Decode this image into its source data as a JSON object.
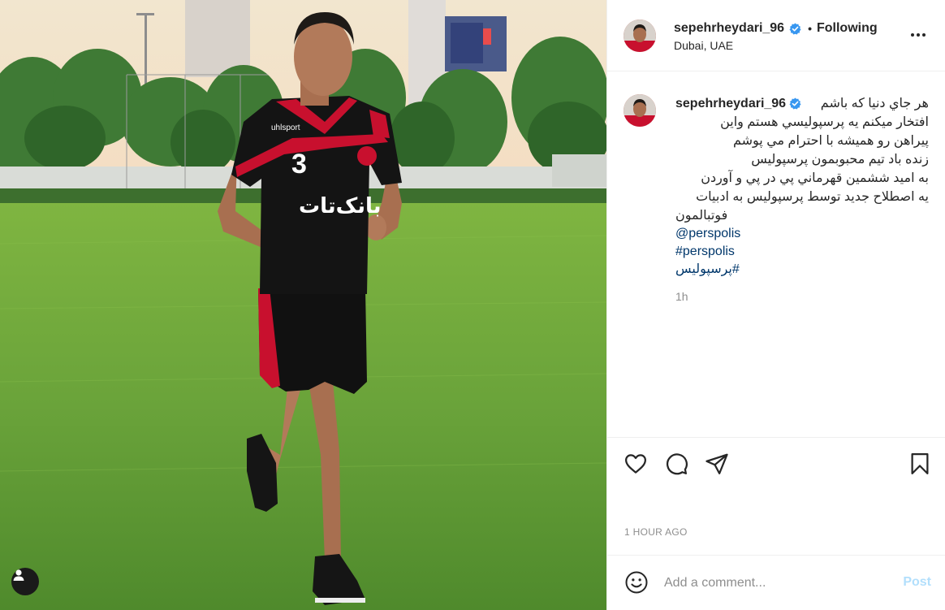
{
  "post": {
    "username": "sepehrheydari_96",
    "follow_status": "Following",
    "location": "Dubai, UAE",
    "jersey_number": "3",
    "jersey_brand": "uhlsport",
    "jersey_sponsor": "بانک‌تات"
  },
  "caption": {
    "username": "sepehrheydari_96",
    "lines": [
      "هر جاي دنيا كه باشم",
      "افتخار ميكنم يه پرسپوليسي هستم واين",
      "پيراهن رو هميشه با احترام مي پوشم",
      "زنده باد تيم محبوبمون پرسپوليس",
      "به اميد ششمين قهرماني پي در پي و آوردن",
      "يه اصطلاح جديد توسط پرسپوليس به ادبيات",
      "فوتبالمون"
    ],
    "mention": "@perspolis",
    "hashtags": [
      "#perspolis",
      "#پرسپوليس"
    ],
    "time_ago": "1h"
  },
  "timestamp": "1 HOUR AGO",
  "comment": {
    "placeholder": "Add a comment...",
    "post_label": "Post"
  },
  "icons": {
    "more": "more-options-icon",
    "like": "heart-icon",
    "comment": "comment-icon",
    "share": "paper-plane-icon",
    "save": "bookmark-icon",
    "emoji": "smiley-icon",
    "tag": "user-tag-icon",
    "verified": "verified-badge-icon"
  },
  "colors": {
    "verified": "#3897f0",
    "link": "#00376b",
    "post_disabled": "#b2dffc",
    "muted": "#8e8e8e",
    "jersey_red": "#c8102e"
  }
}
